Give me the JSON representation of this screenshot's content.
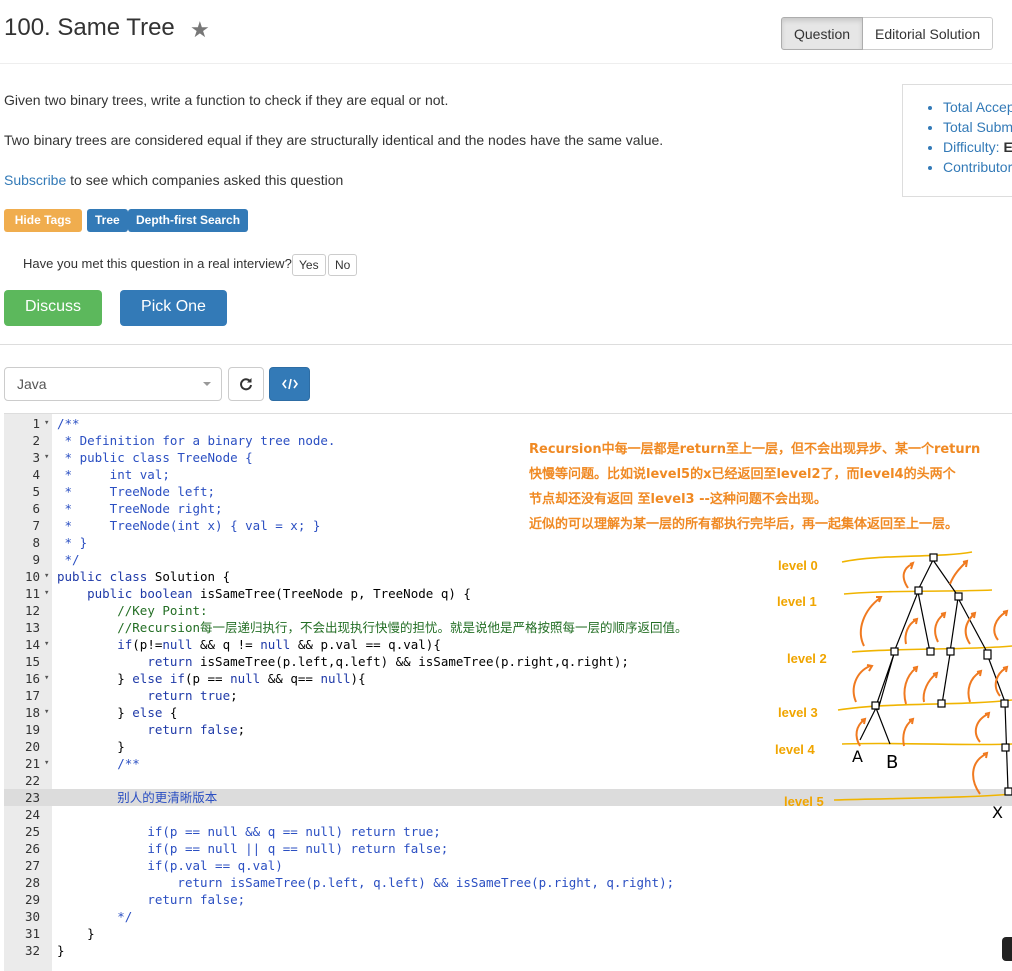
{
  "header": {
    "title": "100. Same Tree",
    "tabs": [
      "Question",
      "Editorial Solution"
    ]
  },
  "description": {
    "p1": "Given two binary trees, write a function to check if they are equal or not.",
    "p2": "Two binary trees are considered equal if they are structurally identical and the nodes have the same value.",
    "subscribe_link": "Subscribe",
    "subscribe_rest": " to see which companies asked this question"
  },
  "stats": {
    "items": [
      "Total Accep",
      "Total Subm",
      "Difficulty: ",
      "Contributor"
    ],
    "difficulty_value": "E"
  },
  "tags": {
    "hide_label": "Hide Tags",
    "items": [
      "Tree",
      "Depth-first Search"
    ]
  },
  "interview": {
    "question": "Have you met this question in a real interview?",
    "yes": "Yes",
    "no": "No"
  },
  "actions": {
    "discuss": "Discuss",
    "pick_one": "Pick One"
  },
  "editor": {
    "language": "Java"
  },
  "annotation": {
    "lines": [
      "Recursion中每一层都是return至上一层，但不会出现异步、某一个return",
      "快慢等问题。比如说level5的x已经返回至level2了，而level4的头两个",
      "节点却还没有返回 至level3 --这种问题不会出现。",
      "近似的可以理解为某一层的所有都执行完毕后，再一起集体返回至上一层。"
    ],
    "levels": [
      "level 0",
      "level 1",
      "level 2",
      "level 3",
      "level 4",
      "level 5"
    ],
    "tree_labels": [
      "A",
      "B",
      "X"
    ]
  },
  "colors": {
    "annotation": "#f08a24",
    "level_label": "#f0a500",
    "primary": "#337ab7",
    "success": "#5cb85c",
    "warning": "#f0ad4e"
  }
}
